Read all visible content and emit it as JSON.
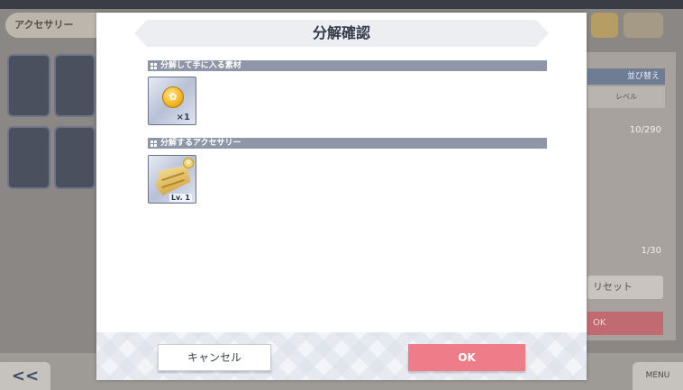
{
  "background": {
    "header_tab_label": "アクセサリー",
    "sort_button_label": "並び替え",
    "level_cell_label": "レベル",
    "count_label": "10/290",
    "count2_label": "1/30",
    "reset_label": "リセット",
    "ok_label": "OK",
    "back_label": "<<",
    "menu_label": "MENU"
  },
  "dialog": {
    "title": "分解確認",
    "section_materials": "分解して手に入る素材",
    "material_quantity": "×1",
    "section_accessories": "分解するアクセサリー",
    "accessory_level": "Lv. 1",
    "cancel_label": "キャンセル",
    "ok_label": "OK"
  },
  "colors": {
    "ok_button": "#ee7d89",
    "section_bar": "#8e96a8"
  }
}
